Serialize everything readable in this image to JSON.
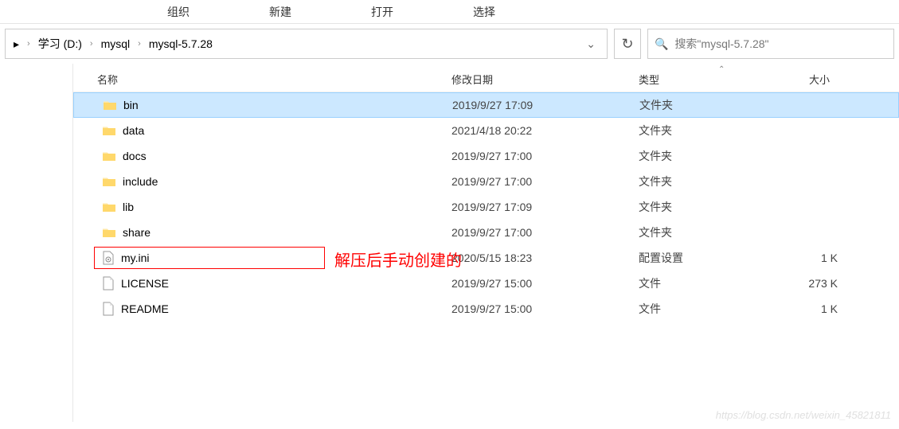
{
  "ribbon": {
    "tabs": [
      "组织",
      "新建",
      "打开",
      "选择"
    ]
  },
  "breadcrumbs": {
    "items": [
      "学习 (D:)",
      "mysql",
      "mysql-5.7.28"
    ]
  },
  "search": {
    "placeholder": "搜索\"mysql-5.7.28\""
  },
  "columns": {
    "name": "名称",
    "date": "修改日期",
    "type": "类型",
    "size": "大小"
  },
  "files": [
    {
      "name": "bin",
      "date": "2019/9/27 17:09",
      "type": "文件夹",
      "size": "",
      "icon": "folder",
      "selected": true
    },
    {
      "name": "data",
      "date": "2021/4/18 20:22",
      "type": "文件夹",
      "size": "",
      "icon": "folder"
    },
    {
      "name": "docs",
      "date": "2019/9/27 17:00",
      "type": "文件夹",
      "size": "",
      "icon": "folder"
    },
    {
      "name": "include",
      "date": "2019/9/27 17:00",
      "type": "文件夹",
      "size": "",
      "icon": "folder"
    },
    {
      "name": "lib",
      "date": "2019/9/27 17:09",
      "type": "文件夹",
      "size": "",
      "icon": "folder"
    },
    {
      "name": "share",
      "date": "2019/9/27 17:00",
      "type": "文件夹",
      "size": "",
      "icon": "folder"
    },
    {
      "name": "my.ini",
      "date": "2020/5/15 18:23",
      "type": "配置设置",
      "size": "1 K",
      "icon": "ini",
      "highlighted": true
    },
    {
      "name": "LICENSE",
      "date": "2019/9/27 15:00",
      "type": "文件",
      "size": "273 K",
      "icon": "file"
    },
    {
      "name": "README",
      "date": "2019/9/27 15:00",
      "type": "文件",
      "size": "1 K",
      "icon": "file"
    }
  ],
  "annotation": {
    "text": "解压后手动创建的"
  },
  "watermark": "https://blog.csdn.net/weixin_45821811"
}
